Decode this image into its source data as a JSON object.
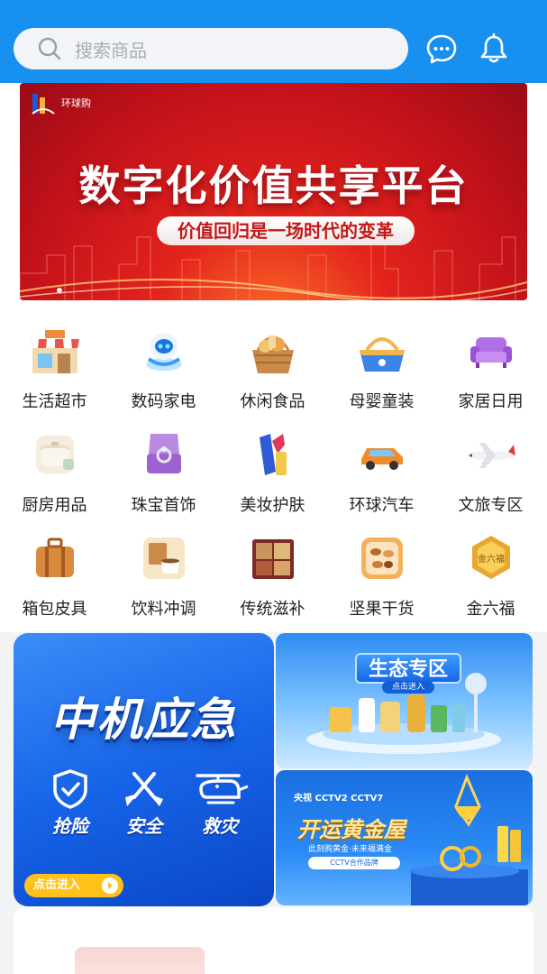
{
  "header": {
    "search_placeholder": "搜索商品",
    "icons": {
      "search": "search-icon",
      "message": "chat-bubble-icon",
      "notifications": "bell-icon"
    },
    "color": "#1890f0"
  },
  "banner": {
    "brand": "环球购",
    "title": "数字化价值共享平台",
    "subtitle": "价值回归是一场时代的变革",
    "dots": 1
  },
  "categories": [
    {
      "label": "生活超市",
      "icon": "shop-icon"
    },
    {
      "label": "数码家电",
      "icon": "robot-icon"
    },
    {
      "label": "休闲食品",
      "icon": "snack-basket-icon"
    },
    {
      "label": "母婴童装",
      "icon": "baby-basket-icon"
    },
    {
      "label": "家居日用",
      "icon": "sofa-icon"
    },
    {
      "label": "厨房用品",
      "icon": "pot-icon"
    },
    {
      "label": "珠宝首饰",
      "icon": "ring-box-icon"
    },
    {
      "label": "美妆护肤",
      "icon": "lipstick-icon"
    },
    {
      "label": "环球汽车",
      "icon": "car-icon"
    },
    {
      "label": "文旅专区",
      "icon": "airplane-icon"
    },
    {
      "label": "箱包皮具",
      "icon": "suitcase-icon"
    },
    {
      "label": "饮料冲调",
      "icon": "coffee-icon"
    },
    {
      "label": "传统滋补",
      "icon": "gift-box-icon"
    },
    {
      "label": "坚果干货",
      "icon": "nuts-icon"
    },
    {
      "label": "金六福",
      "icon": "gold-ingot-icon"
    }
  ],
  "promos": {
    "emergency": {
      "title": "中机应急",
      "items": [
        {
          "label": "抢险",
          "icon": "shield-check-icon"
        },
        {
          "label": "安全",
          "icon": "shovel-icon"
        },
        {
          "label": "救灾",
          "icon": "helicopter-icon"
        }
      ],
      "enter": "点击进入"
    },
    "eco": {
      "title": "生态专区",
      "sub": "点击进入"
    },
    "gold": {
      "logos": "央视 CCTV2 CCTV7",
      "title": "开运黄金屋",
      "sub": "此刻购黄金·未来福满金",
      "badge": "CCTV合作品牌"
    }
  }
}
